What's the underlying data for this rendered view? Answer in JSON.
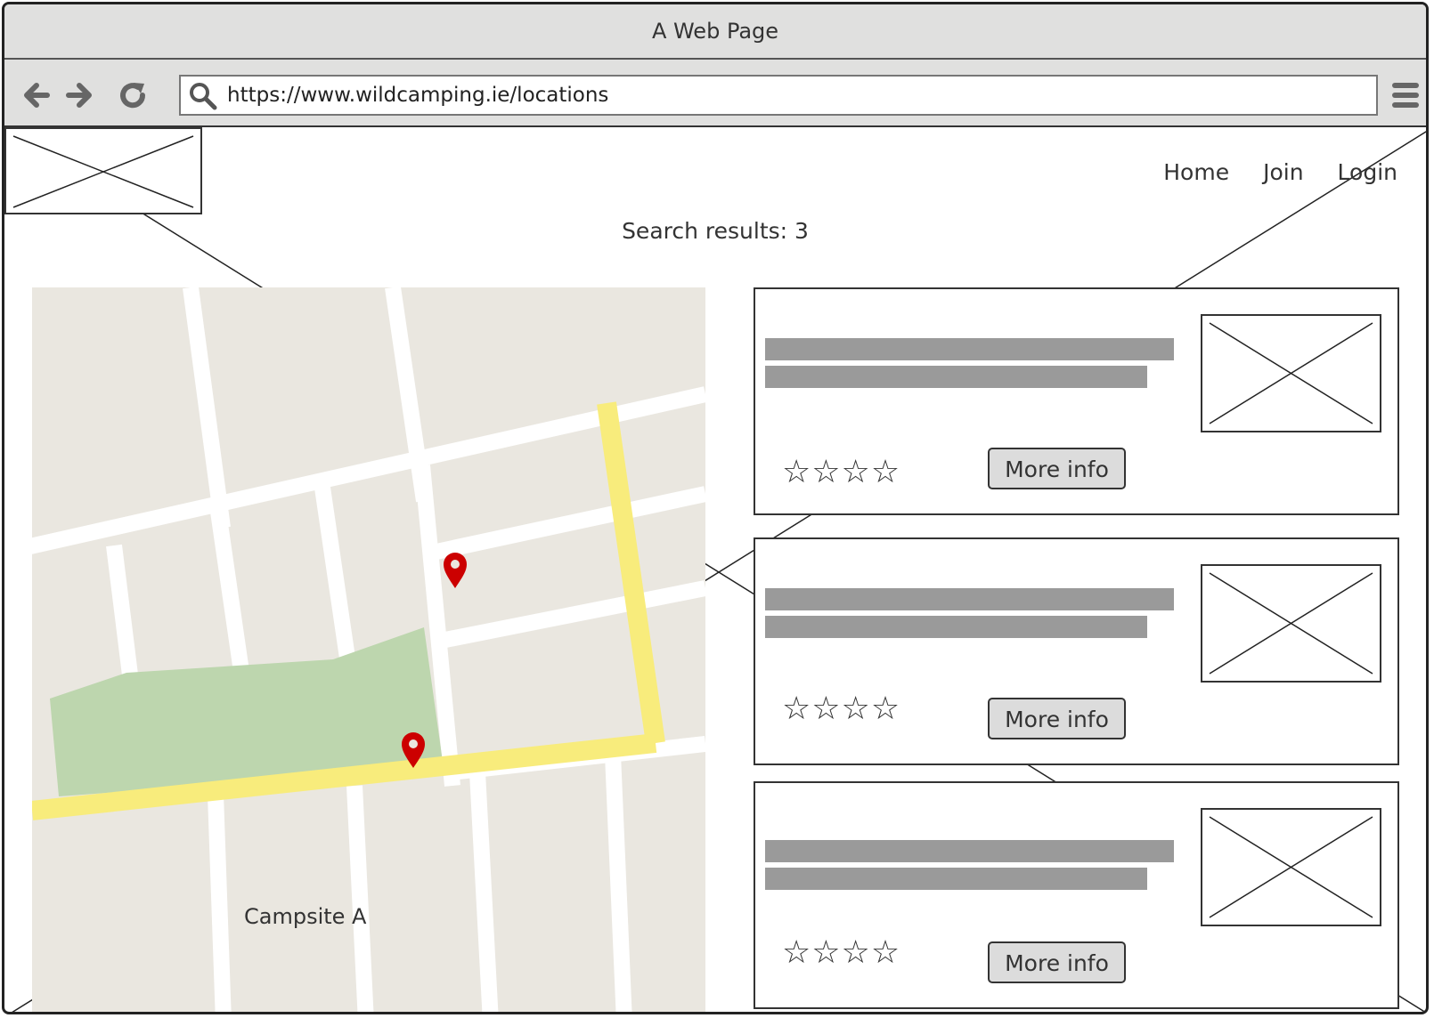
{
  "window": {
    "title": "A Web Page"
  },
  "browser": {
    "url": "https://www.wildcamping.ie/locations",
    "icons": [
      "back-arrow-icon",
      "forward-arrow-icon",
      "reload-icon",
      "search-icon",
      "hamburger-menu-icon"
    ]
  },
  "site": {
    "nav": [
      {
        "label": "Home"
      },
      {
        "label": "Join"
      },
      {
        "label": "Login"
      }
    ]
  },
  "search": {
    "results_text": "Search results: 3"
  },
  "map": {
    "label": "Campsite A",
    "pins": 2,
    "colors": {
      "block": "#eae7e0",
      "road": "#ffffff",
      "highway": "#f8ec7c",
      "park": "#bdd6ae",
      "pin": "#cc0000"
    }
  },
  "results": [
    {
      "button_label": "More info",
      "stars": "☆☆☆☆"
    },
    {
      "button_label": "More info",
      "stars": "☆☆☆☆"
    },
    {
      "button_label": "More info",
      "stars": "☆☆☆☆"
    }
  ]
}
